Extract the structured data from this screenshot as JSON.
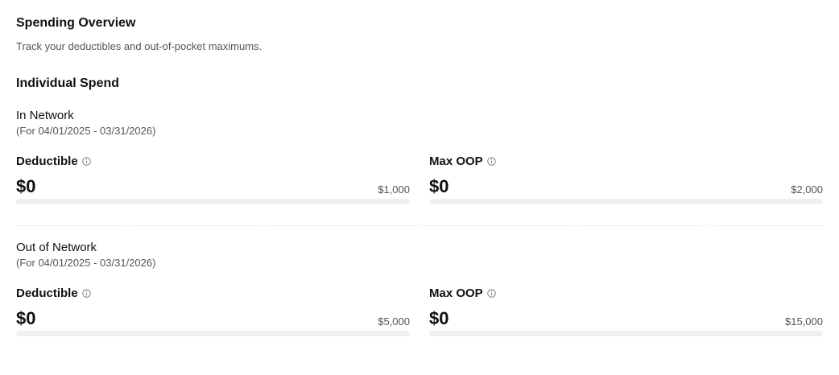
{
  "header": {
    "title": "Spending Overview",
    "subtitle": "Track your deductibles and out-of-pocket maximums."
  },
  "individual_spend": {
    "heading": "Individual Spend",
    "in_network": {
      "title": "In Network",
      "dates": "(For 04/01/2025 - 03/31/2026)",
      "deductible": {
        "label": "Deductible",
        "value": "$0",
        "max": "$1,000",
        "progress": 0,
        "info_icon": "info-icon"
      },
      "max_oop": {
        "label": "Max OOP",
        "value": "$0",
        "max": "$2,000",
        "progress": 0,
        "info_icon": "info-icon"
      }
    },
    "out_of_network": {
      "title": "Out of Network",
      "dates": "(For 04/01/2025 - 03/31/2026)",
      "deductible": {
        "label": "Deductible",
        "value": "$0",
        "max": "$5,000",
        "progress": 0,
        "info_icon": "info-icon"
      },
      "max_oop": {
        "label": "Max OOP",
        "value": "$0",
        "max": "$15,000",
        "progress": 0,
        "info_icon": "info-icon"
      }
    }
  },
  "colors": {
    "text_primary": "#111111",
    "text_secondary": "#555555",
    "progress_track": "#f0f0f0",
    "divider": "#e6e6e6"
  }
}
